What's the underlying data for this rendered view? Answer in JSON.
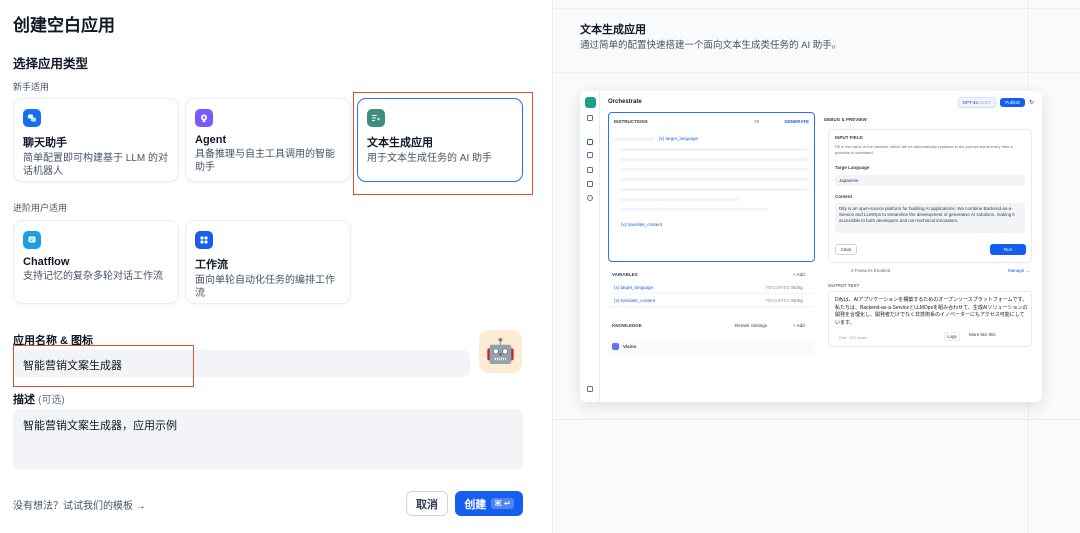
{
  "left": {
    "title": "创建空白应用",
    "section_type": "选择应用类型",
    "beginner_caption": "新手适用",
    "advanced_caption": "进阶用户适用",
    "cards": [
      {
        "title": "聊天助手",
        "desc": "简单配置即可构建基于 LLM 的对话机器人",
        "icon": "chat-icon",
        "color": "#1570ef"
      },
      {
        "title": "Agent",
        "desc": "具备推理与自主工具调用的智能助手",
        "icon": "agent-icon",
        "color": "#7a5af8"
      },
      {
        "title": "文本生成应用",
        "desc": "用于文本生成任务的 AI 助手",
        "icon": "text-gen-icon",
        "color": "#3e8e7e"
      },
      {
        "title": "Chatflow",
        "desc": "支持记忆的复杂多轮对话工作流",
        "icon": "chatflow-icon",
        "color": "#1f9fe0"
      },
      {
        "title": "工作流",
        "desc": "面向单轮自动化任务的编排工作流",
        "icon": "workflow-icon",
        "color": "#155eef"
      }
    ],
    "name_label": "应用名称 & 图标",
    "name_value": "智能营销文案生成器",
    "app_icon": "🤖",
    "desc_label": "描述",
    "desc_optional": "(可选)",
    "desc_value": "智能营销文案生成器，应用示例",
    "template_link": "没有想法？试试我们的模板 →",
    "cancel": "取消",
    "create": "创建",
    "create_kbd": "⌘ ↵"
  },
  "right": {
    "title": "文本生成应用",
    "desc": "通过简单的配置快速搭建一个面向文本生成类任务的 AI 助手。",
    "preview": {
      "title": "Orchestrate",
      "model": "GPT-4o",
      "model_tag": "CHAT",
      "publish": "Publish",
      "instructions": "INSTRUCTIONS",
      "instructions_count": "78",
      "generate": "GENERATE",
      "var_target": "{x} target_language",
      "var_content": "{x} translate_content",
      "variables": "VARIABLES",
      "add": "+ Add",
      "rows": [
        {
          "name": "{x} target_language",
          "req": "REQUIRED",
          "type": "String"
        },
        {
          "name": "{x} translate_content",
          "req": "REQUIRED",
          "type": "String"
        }
      ],
      "knowledge": "KNOWLEDGE",
      "rerank": "Rerank Settings",
      "vision": "Vision",
      "debug": "DEBUG & PREVIEW",
      "input_field": "INPUT FIELD",
      "input_hint": "Fill in the value of the variable, which will be automatically replaced in the prompt words every time a question is submitted.",
      "targe_label": "Targe Language",
      "targe_value": "Japanese",
      "content_label": "Content",
      "content_value": "Dify is an open-source platform for building AI applications. We combine Backend-as-a-Service and LLMOps to streamline the development of generative AI solutions, making it accessible to both developers and non-technical innovators.",
      "clear": "Clear",
      "run": "Run",
      "features": "2 Features Enabled",
      "manage": "Manage →",
      "output_text": "OUTPUT TEXT",
      "output": "Difyは、AIアプリケーションを構築するためのオープンソースプラットフォームです。私たちは、Backend-as-a-ServiceとLLMOpsを組み合わせて、生成AIソリューションの開発を合理化し、開発者だけでなく非技術系のイノベーターにもアクセス可能にしています。",
      "output_meta": "Edit · 321 chars",
      "logs": "Logs",
      "more_like": "More like this"
    }
  }
}
